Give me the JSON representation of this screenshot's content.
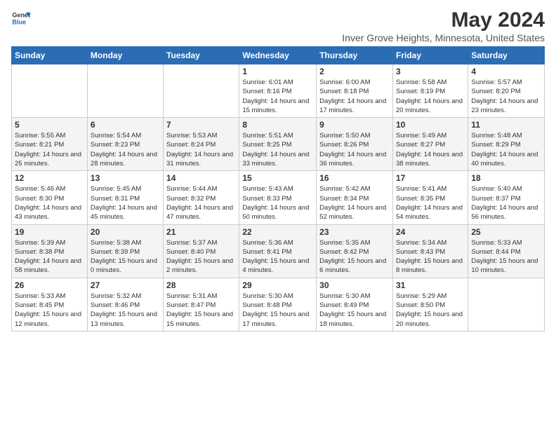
{
  "header": {
    "logo_general": "General",
    "logo_blue": "Blue",
    "title": "May 2024",
    "subtitle": "Inver Grove Heights, Minnesota, United States"
  },
  "days_of_week": [
    "Sunday",
    "Monday",
    "Tuesday",
    "Wednesday",
    "Thursday",
    "Friday",
    "Saturday"
  ],
  "weeks": [
    [
      {
        "day": "",
        "sunrise": "",
        "sunset": "",
        "daylight": ""
      },
      {
        "day": "",
        "sunrise": "",
        "sunset": "",
        "daylight": ""
      },
      {
        "day": "",
        "sunrise": "",
        "sunset": "",
        "daylight": ""
      },
      {
        "day": "1",
        "sunrise": "Sunrise: 6:01 AM",
        "sunset": "Sunset: 8:16 PM",
        "daylight": "Daylight: 14 hours and 15 minutes."
      },
      {
        "day": "2",
        "sunrise": "Sunrise: 6:00 AM",
        "sunset": "Sunset: 8:18 PM",
        "daylight": "Daylight: 14 hours and 17 minutes."
      },
      {
        "day": "3",
        "sunrise": "Sunrise: 5:58 AM",
        "sunset": "Sunset: 8:19 PM",
        "daylight": "Daylight: 14 hours and 20 minutes."
      },
      {
        "day": "4",
        "sunrise": "Sunrise: 5:57 AM",
        "sunset": "Sunset: 8:20 PM",
        "daylight": "Daylight: 14 hours and 23 minutes."
      }
    ],
    [
      {
        "day": "5",
        "sunrise": "Sunrise: 5:55 AM",
        "sunset": "Sunset: 8:21 PM",
        "daylight": "Daylight: 14 hours and 25 minutes."
      },
      {
        "day": "6",
        "sunrise": "Sunrise: 5:54 AM",
        "sunset": "Sunset: 8:23 PM",
        "daylight": "Daylight: 14 hours and 28 minutes."
      },
      {
        "day": "7",
        "sunrise": "Sunrise: 5:53 AM",
        "sunset": "Sunset: 8:24 PM",
        "daylight": "Daylight: 14 hours and 31 minutes."
      },
      {
        "day": "8",
        "sunrise": "Sunrise: 5:51 AM",
        "sunset": "Sunset: 8:25 PM",
        "daylight": "Daylight: 14 hours and 33 minutes."
      },
      {
        "day": "9",
        "sunrise": "Sunrise: 5:50 AM",
        "sunset": "Sunset: 8:26 PM",
        "daylight": "Daylight: 14 hours and 36 minutes."
      },
      {
        "day": "10",
        "sunrise": "Sunrise: 5:49 AM",
        "sunset": "Sunset: 8:27 PM",
        "daylight": "Daylight: 14 hours and 38 minutes."
      },
      {
        "day": "11",
        "sunrise": "Sunrise: 5:48 AM",
        "sunset": "Sunset: 8:29 PM",
        "daylight": "Daylight: 14 hours and 40 minutes."
      }
    ],
    [
      {
        "day": "12",
        "sunrise": "Sunrise: 5:46 AM",
        "sunset": "Sunset: 8:30 PM",
        "daylight": "Daylight: 14 hours and 43 minutes."
      },
      {
        "day": "13",
        "sunrise": "Sunrise: 5:45 AM",
        "sunset": "Sunset: 8:31 PM",
        "daylight": "Daylight: 14 hours and 45 minutes."
      },
      {
        "day": "14",
        "sunrise": "Sunrise: 5:44 AM",
        "sunset": "Sunset: 8:32 PM",
        "daylight": "Daylight: 14 hours and 47 minutes."
      },
      {
        "day": "15",
        "sunrise": "Sunrise: 5:43 AM",
        "sunset": "Sunset: 8:33 PM",
        "daylight": "Daylight: 14 hours and 50 minutes."
      },
      {
        "day": "16",
        "sunrise": "Sunrise: 5:42 AM",
        "sunset": "Sunset: 8:34 PM",
        "daylight": "Daylight: 14 hours and 52 minutes."
      },
      {
        "day": "17",
        "sunrise": "Sunrise: 5:41 AM",
        "sunset": "Sunset: 8:35 PM",
        "daylight": "Daylight: 14 hours and 54 minutes."
      },
      {
        "day": "18",
        "sunrise": "Sunrise: 5:40 AM",
        "sunset": "Sunset: 8:37 PM",
        "daylight": "Daylight: 14 hours and 56 minutes."
      }
    ],
    [
      {
        "day": "19",
        "sunrise": "Sunrise: 5:39 AM",
        "sunset": "Sunset: 8:38 PM",
        "daylight": "Daylight: 14 hours and 58 minutes."
      },
      {
        "day": "20",
        "sunrise": "Sunrise: 5:38 AM",
        "sunset": "Sunset: 8:39 PM",
        "daylight": "Daylight: 15 hours and 0 minutes."
      },
      {
        "day": "21",
        "sunrise": "Sunrise: 5:37 AM",
        "sunset": "Sunset: 8:40 PM",
        "daylight": "Daylight: 15 hours and 2 minutes."
      },
      {
        "day": "22",
        "sunrise": "Sunrise: 5:36 AM",
        "sunset": "Sunset: 8:41 PM",
        "daylight": "Daylight: 15 hours and 4 minutes."
      },
      {
        "day": "23",
        "sunrise": "Sunrise: 5:35 AM",
        "sunset": "Sunset: 8:42 PM",
        "daylight": "Daylight: 15 hours and 6 minutes."
      },
      {
        "day": "24",
        "sunrise": "Sunrise: 5:34 AM",
        "sunset": "Sunset: 8:43 PM",
        "daylight": "Daylight: 15 hours and 8 minutes."
      },
      {
        "day": "25",
        "sunrise": "Sunrise: 5:33 AM",
        "sunset": "Sunset: 8:44 PM",
        "daylight": "Daylight: 15 hours and 10 minutes."
      }
    ],
    [
      {
        "day": "26",
        "sunrise": "Sunrise: 5:33 AM",
        "sunset": "Sunset: 8:45 PM",
        "daylight": "Daylight: 15 hours and 12 minutes."
      },
      {
        "day": "27",
        "sunrise": "Sunrise: 5:32 AM",
        "sunset": "Sunset: 8:46 PM",
        "daylight": "Daylight: 15 hours and 13 minutes."
      },
      {
        "day": "28",
        "sunrise": "Sunrise: 5:31 AM",
        "sunset": "Sunset: 8:47 PM",
        "daylight": "Daylight: 15 hours and 15 minutes."
      },
      {
        "day": "29",
        "sunrise": "Sunrise: 5:30 AM",
        "sunset": "Sunset: 8:48 PM",
        "daylight": "Daylight: 15 hours and 17 minutes."
      },
      {
        "day": "30",
        "sunrise": "Sunrise: 5:30 AM",
        "sunset": "Sunset: 8:49 PM",
        "daylight": "Daylight: 15 hours and 18 minutes."
      },
      {
        "day": "31",
        "sunrise": "Sunrise: 5:29 AM",
        "sunset": "Sunset: 8:50 PM",
        "daylight": "Daylight: 15 hours and 20 minutes."
      },
      {
        "day": "",
        "sunrise": "",
        "sunset": "",
        "daylight": ""
      }
    ]
  ]
}
